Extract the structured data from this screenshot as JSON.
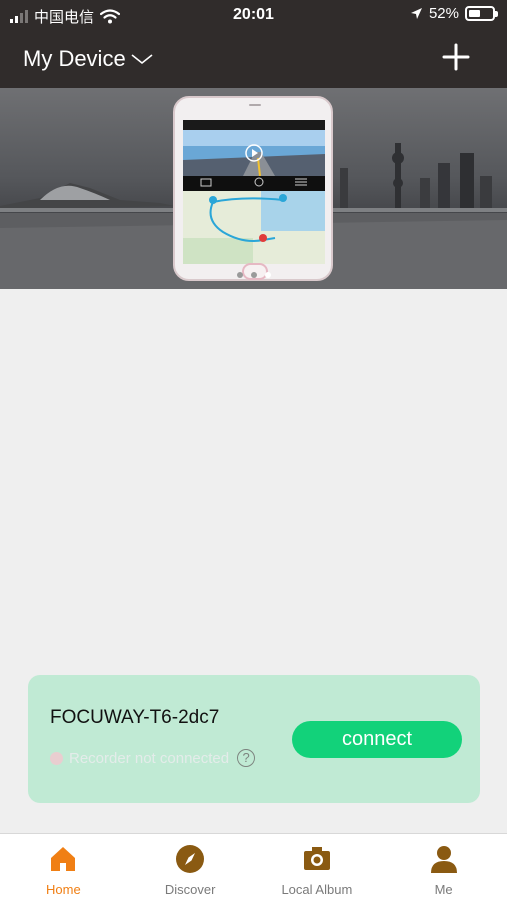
{
  "status_bar": {
    "carrier": "中国电信",
    "time": "20:01",
    "battery": "52%",
    "battery_level": 0.52
  },
  "header": {
    "title": "My Device",
    "dropdown_icon": "chevron-down-icon",
    "add_icon": "plus-icon"
  },
  "banner": {
    "active_slide": 3,
    "slide_count": 3
  },
  "device_card": {
    "name": "FOCUWAY-T6-2dc7",
    "status": "Recorder not connected",
    "connect_label": "connect"
  },
  "tabs": [
    {
      "label": "Home",
      "icon": "home-icon",
      "active": true
    },
    {
      "label": "Discover",
      "icon": "compass-icon",
      "active": false
    },
    {
      "label": "Local Album",
      "icon": "camera-icon",
      "active": false
    },
    {
      "label": "Me",
      "icon": "person-icon",
      "active": false
    }
  ],
  "colors": {
    "header_bg": "#302c2b",
    "page_bg": "#efefef",
    "card_bg": "#c0ead4",
    "connect_button": "#12d27a",
    "tab_active": "#f07f14",
    "tab_icon": "#8a5a12"
  }
}
